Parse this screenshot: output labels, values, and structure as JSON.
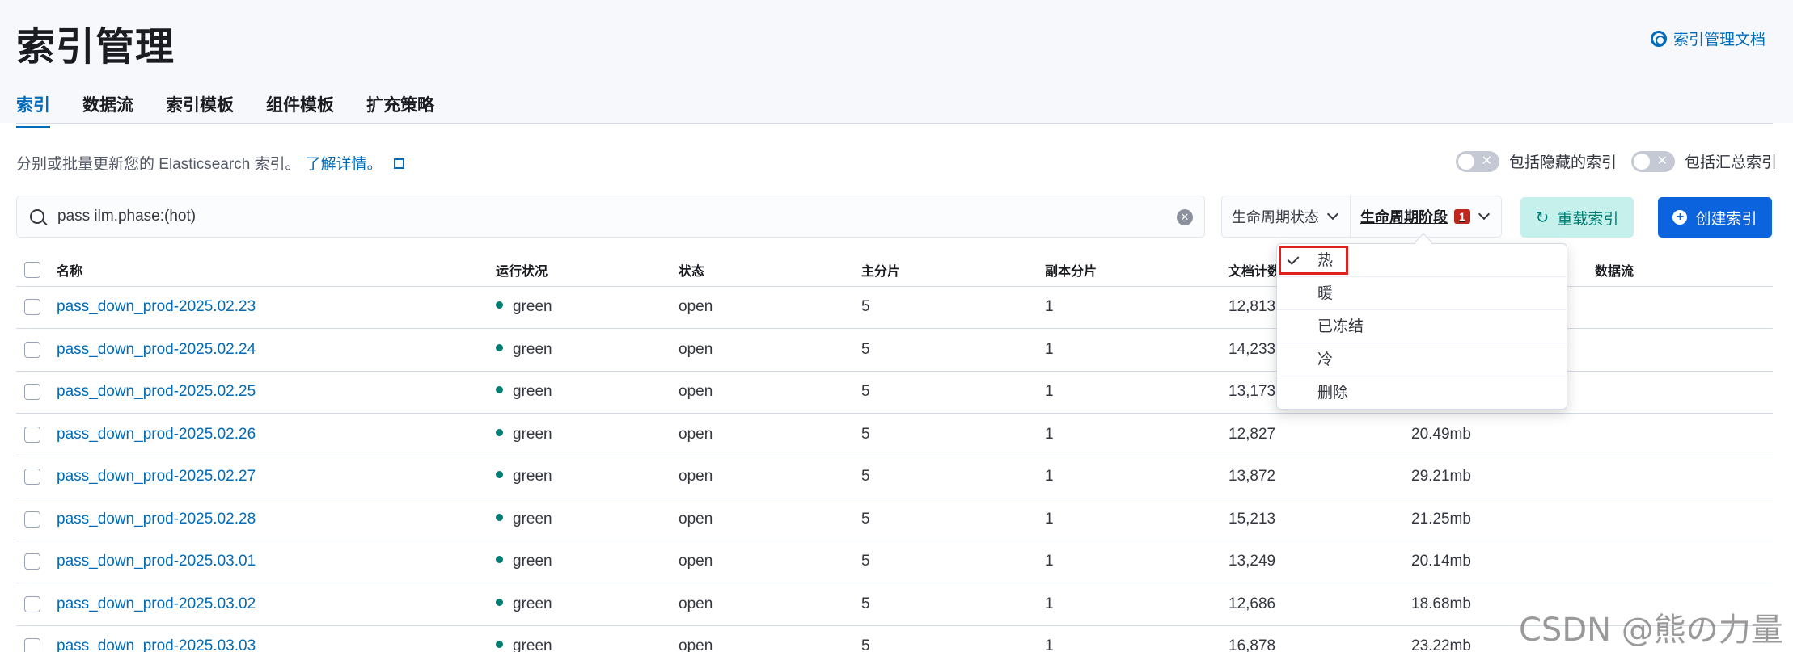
{
  "header": {
    "title": "索引管理",
    "docs_link": "索引管理文档"
  },
  "tabs": [
    "索引",
    "数据流",
    "索引模板",
    "组件模板",
    "扩充策略"
  ],
  "description": {
    "text": "分别或批量更新您的 Elasticsearch 索引。",
    "link": "了解详情。"
  },
  "toggles": {
    "hidden_label": "包括隐藏的索引",
    "rollup_label": "包括汇总索引"
  },
  "search": {
    "value": "pass ilm.phase:(hot)"
  },
  "filters": {
    "lifecycle_status": "生命周期状态",
    "lifecycle_phase": "生命周期阶段",
    "phase_count": "1"
  },
  "buttons": {
    "reload": "重载索引",
    "create": "创建索引"
  },
  "table": {
    "headers": [
      "名称",
      "运行状况",
      "状态",
      "主分片",
      "副本分片",
      "文档计数",
      "",
      "数据流"
    ],
    "rows": [
      {
        "name": "pass_down_prod-2025.02.23",
        "health": "green",
        "status": "open",
        "primary": "5",
        "replica": "1",
        "docs": "12,813",
        "size": ""
      },
      {
        "name": "pass_down_prod-2025.02.24",
        "health": "green",
        "status": "open",
        "primary": "5",
        "replica": "1",
        "docs": "14,233",
        "size": ""
      },
      {
        "name": "pass_down_prod-2025.02.25",
        "health": "green",
        "status": "open",
        "primary": "5",
        "replica": "1",
        "docs": "13,173",
        "size": ""
      },
      {
        "name": "pass_down_prod-2025.02.26",
        "health": "green",
        "status": "open",
        "primary": "5",
        "replica": "1",
        "docs": "12,827",
        "size": "20.49mb"
      },
      {
        "name": "pass_down_prod-2025.02.27",
        "health": "green",
        "status": "open",
        "primary": "5",
        "replica": "1",
        "docs": "13,872",
        "size": "29.21mb"
      },
      {
        "name": "pass_down_prod-2025.02.28",
        "health": "green",
        "status": "open",
        "primary": "5",
        "replica": "1",
        "docs": "15,213",
        "size": "21.25mb"
      },
      {
        "name": "pass_down_prod-2025.03.01",
        "health": "green",
        "status": "open",
        "primary": "5",
        "replica": "1",
        "docs": "13,249",
        "size": "20.14mb"
      },
      {
        "name": "pass_down_prod-2025.03.02",
        "health": "green",
        "status": "open",
        "primary": "5",
        "replica": "1",
        "docs": "12,686",
        "size": "18.68mb"
      },
      {
        "name": "pass_down_prod-2025.03.03",
        "health": "green",
        "status": "open",
        "primary": "5",
        "replica": "1",
        "docs": "16,878",
        "size": "23.22mb"
      }
    ]
  },
  "phase_options": [
    {
      "label": "热",
      "checked": true
    },
    {
      "label": "暖",
      "checked": false
    },
    {
      "label": "已冻结",
      "checked": false
    },
    {
      "label": "冷",
      "checked": false
    },
    {
      "label": "删除",
      "checked": false
    }
  ],
  "watermark": "CSDN @熊の力量",
  "colors": {
    "link": "#006bb8",
    "health_green": "#017d73",
    "primary_button": "#0b64dd",
    "badge": "#bd271e",
    "highlight": "#e0201c"
  }
}
